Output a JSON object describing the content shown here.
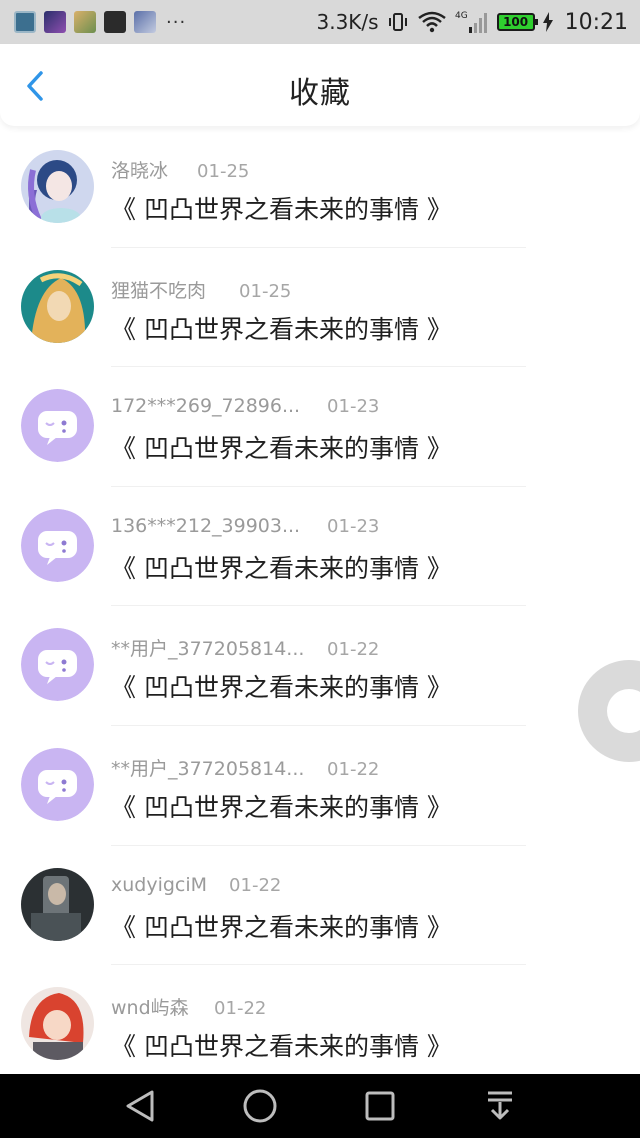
{
  "status_bar": {
    "notification_icons": [
      "gallery-app-icon",
      "game-app-icon",
      "photo-app-icon",
      "dark-app-icon",
      "grid-app-icon"
    ],
    "more": "···",
    "net_speed": "3.3K/s",
    "signal_label": "4G",
    "battery": "100",
    "time": "10:21"
  },
  "header": {
    "title": "收藏",
    "back_icon": "chevron-left-icon",
    "accent_color": "#2f95e8"
  },
  "items": [
    {
      "user": "洛晓冰",
      "date": "01-25",
      "title": "《 凹凸世界之看未来的事情 》",
      "avatar": "anime-girl-purple"
    },
    {
      "user": "狸猫不吃肉",
      "date": "01-25",
      "title": "《 凹凸世界之看未来的事情 》",
      "avatar": "anime-blonde"
    },
    {
      "user": "172***269_72896...",
      "date": "01-23",
      "title": "《 凹凸世界之看未来的事情 》",
      "avatar": "default-chat-bubble"
    },
    {
      "user": "136***212_39903...",
      "date": "01-23",
      "title": "《 凹凸世界之看未来的事情 》",
      "avatar": "default-chat-bubble"
    },
    {
      "user": "**用户_377205814...",
      "date": "01-22",
      "title": "《 凹凸世界之看未来的事情 》",
      "avatar": "default-chat-bubble"
    },
    {
      "user": "**用户_377205814...",
      "date": "01-22",
      "title": "《 凹凸世界之看未来的事情 》",
      "avatar": "default-chat-bubble"
    },
    {
      "user": "xudyigciM",
      "date": "01-22",
      "title": "《 凹凸世界之看未来的事情 》",
      "avatar": "dark-photo"
    },
    {
      "user": "wnd屿森",
      "date": "01-22",
      "title": "《 凹凸世界之看未来的事情 》",
      "avatar": "anime-redhair"
    }
  ],
  "default_avatar_color": "#c9b5f2",
  "floating_button": "assistive-touch-icon",
  "nav_bar": [
    "back-triangle-icon",
    "home-circle-icon",
    "recents-square-icon",
    "notification-pull-icon"
  ]
}
